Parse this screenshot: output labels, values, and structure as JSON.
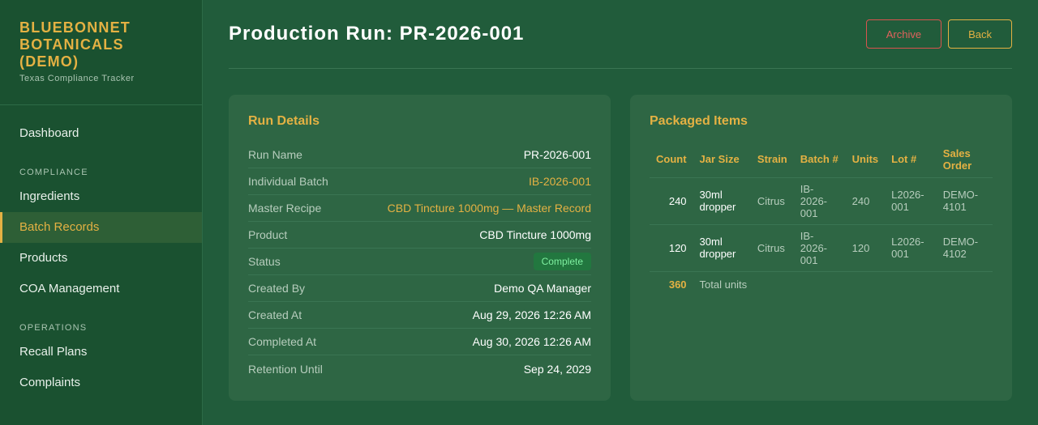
{
  "brand": {
    "title_lines": [
      "BLUEBONNET",
      "BOTANICALS",
      "(DEMO)"
    ],
    "subtitle": "Texas Compliance Tracker"
  },
  "nav": {
    "dashboard": "Dashboard",
    "section_compliance": "COMPLIANCE",
    "ingredients": "Ingredients",
    "batch_records": "Batch Records",
    "products": "Products",
    "coa": "COA Management",
    "section_operations": "OPERATIONS",
    "recall_plans": "Recall Plans",
    "complaints": "Complaints"
  },
  "header": {
    "title": "Production Run: PR-2026-001",
    "archive_label": "Archive",
    "back_label": "Back"
  },
  "details": {
    "title": "Run Details",
    "rows": [
      {
        "label": "Run Name",
        "value": "PR-2026-001"
      },
      {
        "label": "Individual Batch",
        "value": "IB-2026-001"
      },
      {
        "label": "Master Recipe",
        "value": "CBD Tincture 1000mg — Master Record"
      },
      {
        "label": "Product",
        "value": "CBD Tincture 1000mg"
      },
      {
        "label": "Status",
        "value": "Complete"
      },
      {
        "label": "Created By",
        "value": "Demo QA Manager"
      },
      {
        "label": "Created At",
        "value": "Aug 29, 2026 12:26 AM"
      },
      {
        "label": "Completed At",
        "value": "Aug 30, 2026 12:26 AM"
      },
      {
        "label": "Retention Until",
        "value": "Sep 24, 2029"
      }
    ]
  },
  "packaged": {
    "title": "Packaged Items",
    "columns": [
      "Count",
      "Jar Size",
      "Strain",
      "Batch #",
      "Units",
      "Lot #",
      "Sales Order"
    ],
    "rows": [
      {
        "count": "240",
        "jar_size": "30ml dropper",
        "strain": "Citrus",
        "batch": "IB-2026-001",
        "units": "240",
        "lot": "L2026-001",
        "sales_order": "DEMO-4101"
      },
      {
        "count": "120",
        "jar_size": "30ml dropper",
        "strain": "Citrus",
        "batch": "IB-2026-001",
        "units": "120",
        "lot": "L2026-001",
        "sales_order": "DEMO-4102"
      }
    ],
    "total_count": "360",
    "total_label": "Total units"
  },
  "colors": {
    "accent": "#e4b143",
    "danger": "#d9534f",
    "success": "#7ef0a0"
  }
}
